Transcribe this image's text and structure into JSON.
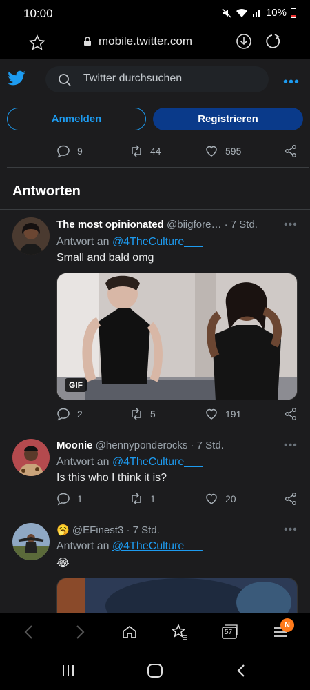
{
  "status_bar": {
    "time": "10:00",
    "battery": "10%"
  },
  "browser": {
    "url": "mobile.twitter.com",
    "tabs_count": "57",
    "menu_badge": "N"
  },
  "twitter": {
    "search_placeholder": "Twitter durchsuchen",
    "login_label": "Anmelden",
    "register_label": "Registrieren",
    "main_stats": {
      "replies": "9",
      "retweets": "44",
      "likes": "595"
    },
    "section_title": "Antworten"
  },
  "tweets": [
    {
      "name": "The most opinionated",
      "handle": "@biigfore…",
      "time": "· 7 Std.",
      "reply_prefix": "Antwort an",
      "reply_to": "@4TheCulture___",
      "text": "Small and bald omg",
      "media_badge": "GIF",
      "replies": "2",
      "retweets": "5",
      "likes": "191"
    },
    {
      "name": "Moonie",
      "handle": "@hennyponderocks",
      "time": "· 7 Std.",
      "reply_prefix": "Antwort an",
      "reply_to": "@4TheCulture___",
      "text": "Is this who I think it is?",
      "replies": "1",
      "retweets": "1",
      "likes": "20"
    },
    {
      "name": "🥱",
      "handle": "@EFinest3",
      "time": "· 7 Std.",
      "reply_prefix": "Antwort an",
      "reply_to": "@4TheCulture___",
      "text": "😂"
    }
  ],
  "colors": {
    "accent": "#1d9bf0",
    "register_bg": "#0a3a8a",
    "badge": "#ff7a1a"
  }
}
